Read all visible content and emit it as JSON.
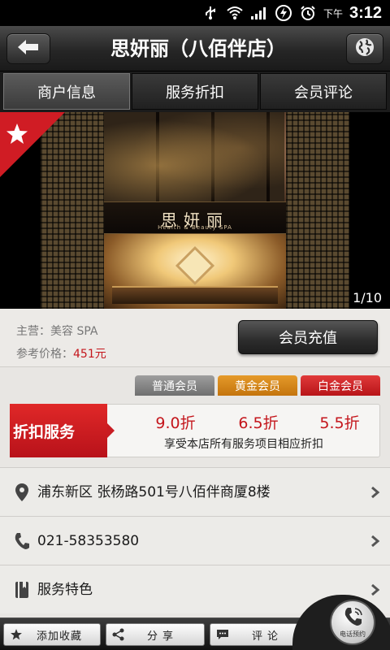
{
  "status_bar": {
    "ampm": "下午",
    "time": "3:12"
  },
  "header": {
    "title": "思妍丽（八佰伴店）"
  },
  "tabs": [
    {
      "label": "商户信息",
      "active": true
    },
    {
      "label": "服务折扣",
      "active": false
    },
    {
      "label": "会员评论",
      "active": false
    }
  ],
  "gallery": {
    "counter": "1/10",
    "sign_text": "思妍丽",
    "sign_subtext": "Health & Beauty SPA"
  },
  "info": {
    "main_business_label": "主营：",
    "main_business_value": "美容 SPA",
    "price_label": "参考价格：",
    "price_value": "451元",
    "recharge_label": "会员充值"
  },
  "membership": {
    "tiers": [
      {
        "label": "普通会员",
        "color": "#8a8a8a"
      },
      {
        "label": "黄金会员",
        "color": "#d4830f"
      },
      {
        "label": "白金会员",
        "color": "#c81c22"
      }
    ]
  },
  "discount": {
    "label": "折扣服务",
    "values": [
      "9.0折",
      "6.5折",
      "5.5折"
    ],
    "note": "享受本店所有服务项目相应折扣"
  },
  "details": {
    "address": "浦东新区 张杨路501号八佰伴商厦8楼",
    "phone": "021-58353580",
    "features": "服务特色"
  },
  "toolbar": {
    "favorite_label": "添加收藏",
    "share_label": "分享",
    "comment_label": "评论",
    "call_label": "电话预约"
  },
  "colors": {
    "accent_red": "#c4161c",
    "gold": "#d4830f",
    "gray": "#8a8a8a"
  }
}
